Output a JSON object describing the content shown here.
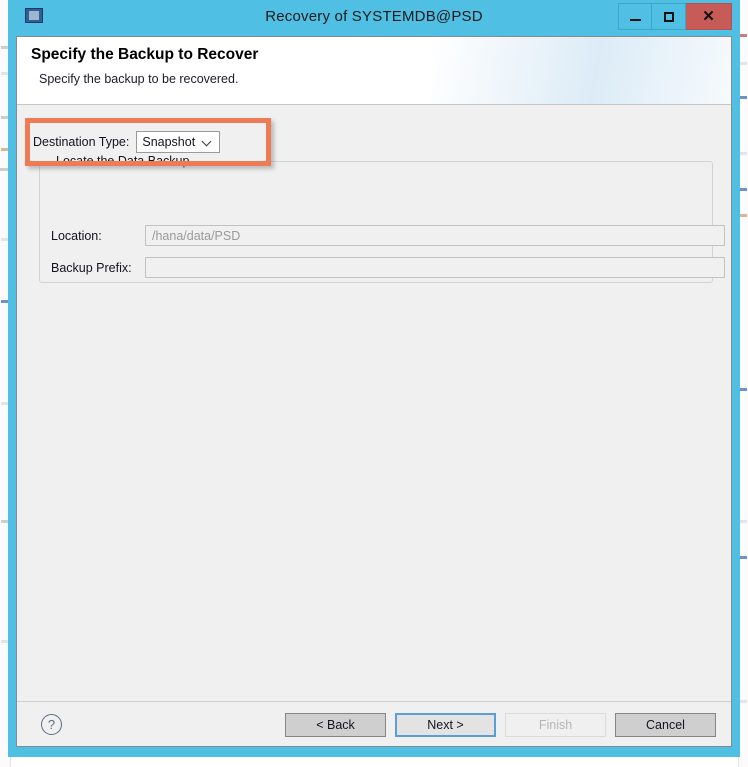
{
  "window": {
    "title": "Recovery of SYSTEMDB@PSD",
    "icon": "app-icon",
    "controls": {
      "minimize": "minimize-icon",
      "maximize": "maximize-icon",
      "close": "close-icon"
    },
    "frame_color": "#4FC0E3",
    "close_color": "#C75B58"
  },
  "header": {
    "title": "Specify the Backup to Recover",
    "subtitle": "Specify the backup to be recovered."
  },
  "annotation": {
    "highlight_color": "#EC7B56",
    "target": "destination-type-row"
  },
  "form": {
    "destination_type": {
      "label": "Destination Type:",
      "value": "Snapshot",
      "arrow_icon": "chevron-down-icon"
    },
    "group": {
      "title": "Locate the Data Backup",
      "fields": [
        {
          "label": "Location:",
          "value": "/hana/data/PSD",
          "placeholder": "",
          "disabled": true
        },
        {
          "label": "Backup Prefix:",
          "value": "",
          "placeholder": "",
          "disabled": false
        }
      ]
    }
  },
  "footer": {
    "help_icon": "help-icon",
    "help_glyph": "?",
    "buttons": [
      {
        "label": "< Back",
        "state": "normal"
      },
      {
        "label": "Next >",
        "state": "focused"
      },
      {
        "label": "Finish",
        "state": "disabled"
      },
      {
        "label": "Cancel",
        "state": "normal"
      }
    ]
  }
}
